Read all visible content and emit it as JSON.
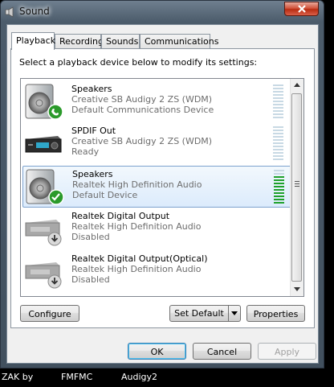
{
  "window": {
    "title": "Sound"
  },
  "tabs": [
    {
      "label": "Playback",
      "active": true
    },
    {
      "label": "Recording",
      "active": false
    },
    {
      "label": "Sounds",
      "active": false
    },
    {
      "label": "Communications",
      "active": false
    }
  ],
  "instruction": "Select a playback device below to modify its settings:",
  "devices": [
    {
      "name": "Speakers",
      "driver": "Creative SB Audigy 2 ZS (WDM)",
      "status": "Default Communications Device",
      "icon": "speaker-phone-icon",
      "selected": false,
      "meter_level": 0
    },
    {
      "name": "SPDIF Out",
      "driver": "Creative SB Audigy 2 ZS (WDM)",
      "status": "Ready",
      "icon": "digital-receiver-icon",
      "selected": false,
      "meter_level": 0
    },
    {
      "name": "Speakers",
      "driver": "Realtek High Definition Audio",
      "status": "Default Device",
      "icon": "speaker-check-icon",
      "selected": true,
      "meter_level": 0.8
    },
    {
      "name": "Realtek Digital Output",
      "driver": "Realtek High Definition Audio",
      "status": "Disabled",
      "icon": "digital-output-disabled-icon",
      "selected": false,
      "meter_level": null
    },
    {
      "name": "Realtek Digital Output(Optical)",
      "driver": "Realtek High Definition Audio",
      "status": "Disabled",
      "icon": "optical-output-disabled-icon",
      "selected": false,
      "meter_level": null
    }
  ],
  "buttons": {
    "configure": "Configure",
    "set_default": "Set Default",
    "properties": "Properties",
    "ok": "OK",
    "cancel": "Cancel",
    "apply": "Apply"
  },
  "taskbar": [
    "ZAK by",
    "FMFMC",
    "Audigy2"
  ],
  "colors": {
    "meter_active": "#1fa12b",
    "meter_idle": "#c8d9e4",
    "selection": "#dcebfc",
    "close_button": "#c94a30"
  }
}
